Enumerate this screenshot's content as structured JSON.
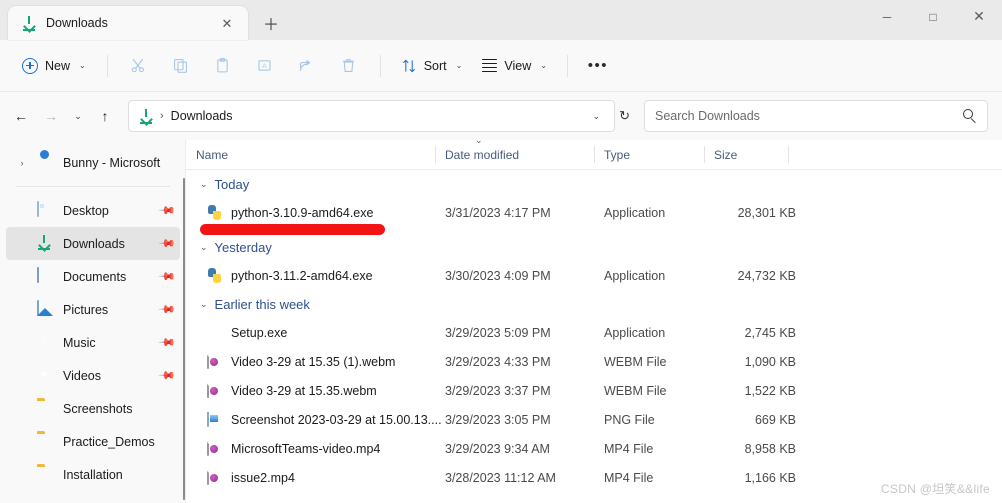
{
  "window": {
    "tab_title": "Downloads",
    "tab_icon": "download-arrow-icon",
    "close_tab_glyph": "✕",
    "new_tab_glyph": "＋",
    "minimize_glyph": "─",
    "maximize_glyph": "□",
    "close_glyph": "✕"
  },
  "toolbar": {
    "new_label": "New",
    "new_chevron": "⌄",
    "cut_label": "Cut",
    "copy_label": "Copy",
    "paste_label": "Paste",
    "rename_label": "Rename",
    "share_label": "Share",
    "delete_label": "Delete",
    "sort_label": "Sort",
    "sort_chevron": "⌄",
    "view_label": "View",
    "view_chevron": "⌄",
    "more_label": "•••"
  },
  "addressbar": {
    "back_glyph": "←",
    "forward_glyph": "→",
    "recent_glyph": "⌄",
    "up_glyph": "↑",
    "breadcrumb_icon": "download-arrow-icon",
    "breadcrumb_sep": "›",
    "breadcrumb_text": "Downloads",
    "dropdown_glyph": "⌄",
    "refresh_glyph": "↻"
  },
  "search": {
    "placeholder": "Search Downloads",
    "value": "",
    "icon": "search-icon"
  },
  "sidebar": {
    "onedrive": {
      "label": "Bunny - Microsoft",
      "expander": "›",
      "icon": "cloud-icon"
    },
    "items": [
      {
        "label": "Desktop",
        "icon": "desktop-icon",
        "pinned": true,
        "selected": false
      },
      {
        "label": "Downloads",
        "icon": "download-icon",
        "pinned": true,
        "selected": true
      },
      {
        "label": "Documents",
        "icon": "document-icon",
        "pinned": true,
        "selected": false
      },
      {
        "label": "Pictures",
        "icon": "picture-icon",
        "pinned": true,
        "selected": false
      },
      {
        "label": "Music",
        "icon": "music-icon",
        "pinned": true,
        "selected": false
      },
      {
        "label": "Videos",
        "icon": "video-icon",
        "pinned": true,
        "selected": false
      },
      {
        "label": "Screenshots",
        "icon": "folder-icon",
        "pinned": false,
        "selected": false
      },
      {
        "label": "Practice_Demos",
        "icon": "folder-icon",
        "pinned": false,
        "selected": false
      },
      {
        "label": "Installation",
        "icon": "folder-icon",
        "pinned": false,
        "selected": false
      }
    ],
    "pin_glyph": "📌"
  },
  "columns": {
    "name": "Name",
    "date_modified": "Date modified",
    "type": "Type",
    "size": "Size",
    "sort_indicator": "⌄"
  },
  "groups": [
    {
      "label": "Today",
      "chevron": "⌄",
      "rows": [
        {
          "name": "python-3.10.9-amd64.exe",
          "date": "3/31/2023 4:17 PM",
          "type": "Application",
          "size": "28,301 KB",
          "icon": "python-installer-icon"
        }
      ]
    },
    {
      "label": "Yesterday",
      "chevron": "⌄",
      "rows": [
        {
          "name": "python-3.11.2-amd64.exe",
          "date": "3/30/2023 4:09 PM",
          "type": "Application",
          "size": "24,732 KB",
          "icon": "python-installer-icon"
        }
      ]
    },
    {
      "label": "Earlier this week",
      "chevron": "⌄",
      "rows": [
        {
          "name": "Setup.exe",
          "date": "3/29/2023 5:09 PM",
          "type": "Application",
          "size": "2,745 KB",
          "icon": "exe-icon"
        },
        {
          "name": "Video 3-29 at 15.35 (1).webm",
          "date": "3/29/2023 4:33 PM",
          "type": "WEBM File",
          "size": "1,090 KB",
          "icon": "media-file-icon"
        },
        {
          "name": "Video 3-29 at 15.35.webm",
          "date": "3/29/2023 3:37 PM",
          "type": "WEBM File",
          "size": "1,522 KB",
          "icon": "media-file-icon"
        },
        {
          "name": "Screenshot 2023-03-29 at 15.00.13....",
          "date": "3/29/2023 3:05 PM",
          "type": "PNG File",
          "size": "669 KB",
          "icon": "png-file-icon"
        },
        {
          "name": "MicrosoftTeams-video.mp4",
          "date": "3/29/2023 9:34 AM",
          "type": "MP4 File",
          "size": "8,958 KB",
          "icon": "media-file-icon"
        },
        {
          "name": "issue2.mp4",
          "date": "3/28/2023 11:12 AM",
          "type": "MP4 File",
          "size": "1,166 KB",
          "icon": "media-file-icon"
        }
      ]
    }
  ],
  "annotation": {
    "type": "red-highlight-bar",
    "color": "#f21414"
  },
  "watermark": {
    "text": "CSDN @坦笑&&life"
  },
  "colors": {
    "accent_blue": "#1a6fd4",
    "group_header_blue": "#2f4f8f",
    "selected_gray": "#e4e4e4",
    "download_green": "#12a77a",
    "annotation_red": "#f21414"
  }
}
